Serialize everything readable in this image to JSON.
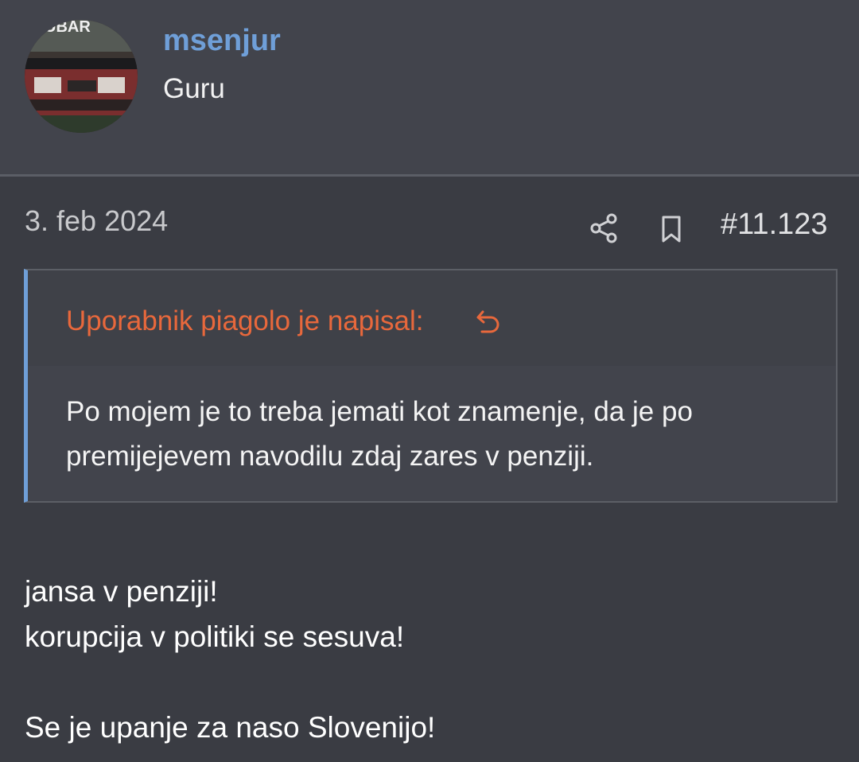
{
  "user": {
    "name": "msenjur",
    "title": "Guru",
    "avatar_text": "UBAR"
  },
  "post": {
    "date": "3. feb 2024",
    "number": "#11.123",
    "quote": {
      "author_line": "Uporabnik piagolo je napisal:",
      "lines": [
        "Po mojem je to treba jemati kot znamenje, da je po",
        "premijejevem navodilu zdaj zares v penziji."
      ]
    },
    "body_lines": [
      "jansa v penziji!",
      "korupcija v politiki se sesuva!",
      "Se je upanje za naso Slovenijo!"
    ]
  },
  "icons": {
    "share": "share-icon",
    "bookmark": "bookmark-icon",
    "quote_jump": "reply-arrow-icon"
  },
  "colors": {
    "username": "#6f9fd8",
    "quote_author": "#e8683c",
    "quote_border": "#6f9fd8",
    "background": "#3a3c43"
  }
}
